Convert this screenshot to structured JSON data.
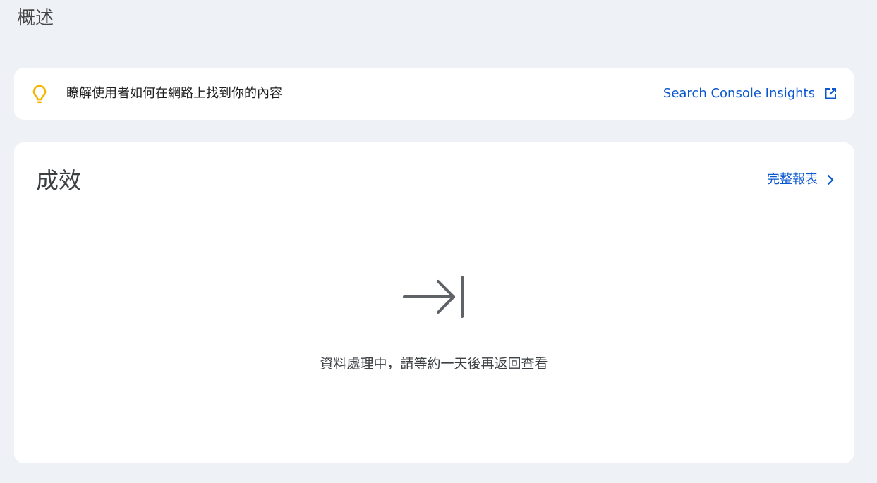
{
  "header": {
    "title": "概述"
  },
  "tip": {
    "icon": "lightbulb-icon",
    "icon_color": "#f4b400",
    "text": "瞭解使用者如何在網路上找到你的內容",
    "link_label": "Search Console Insights",
    "link_icon": "open-in-new-icon",
    "link_color": "#0b57d0"
  },
  "performance": {
    "title": "成效",
    "full_report_label": "完整報表",
    "full_report_icon": "chevron-right-icon",
    "status_icon": "arrow-to-end-icon",
    "status_text": "資料處理中，請等約一天後再返回查看"
  }
}
